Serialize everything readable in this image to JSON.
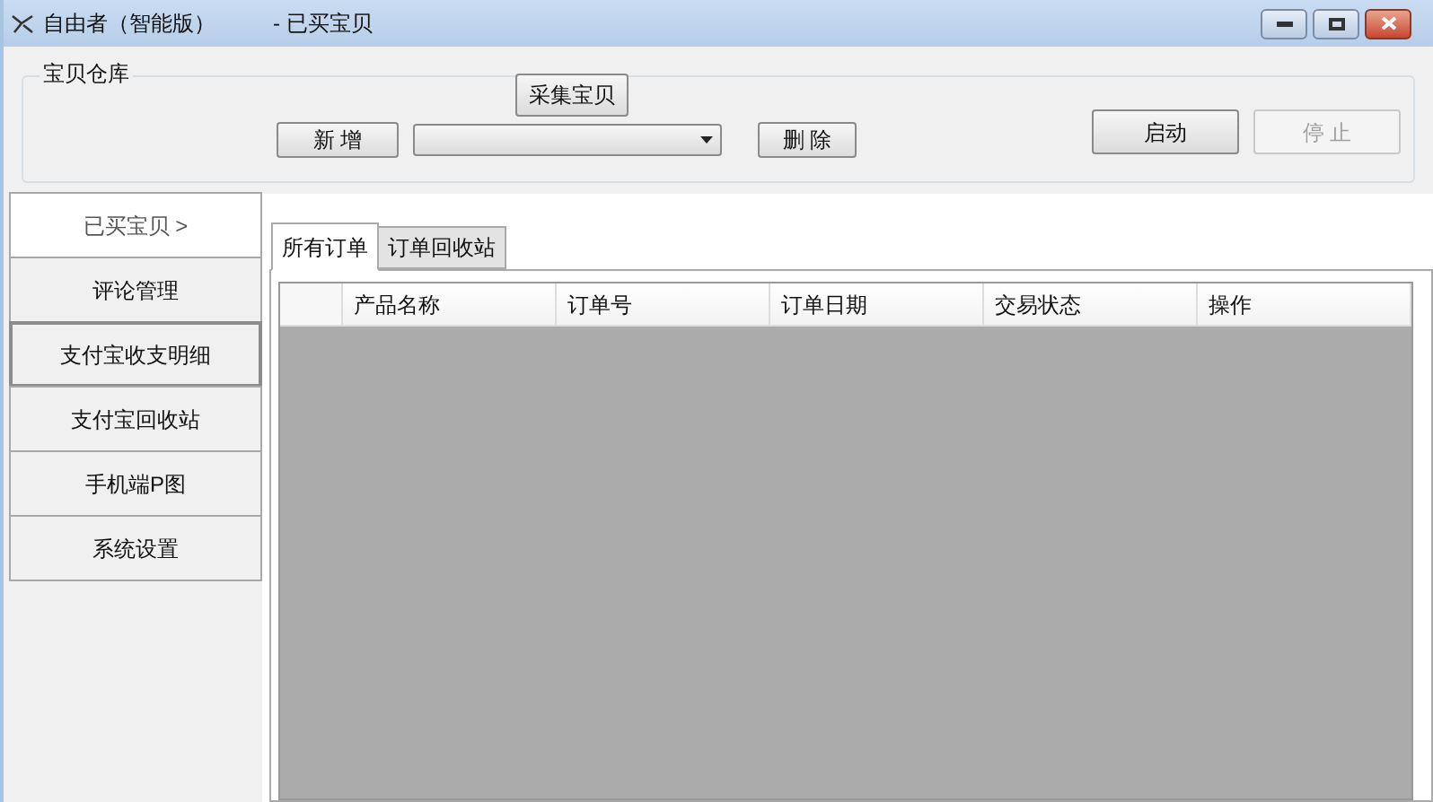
{
  "window": {
    "title": "自由者（智能版）",
    "subtitle": "- 已买宝贝"
  },
  "group": {
    "title": "宝贝仓库",
    "buttons": [
      {
        "label": "采集宝贝",
        "disabled": false
      },
      {
        "label": "新 增",
        "disabled": false
      },
      {
        "label": "删 除",
        "disabled": false
      },
      {
        "label": "启动",
        "disabled": false
      },
      {
        "label": "停 止",
        "disabled": true
      }
    ]
  },
  "sidebar": {
    "items": [
      {
        "label": "已买宝贝 >",
        "selected": true,
        "focused": false
      },
      {
        "label": "评论管理",
        "selected": false,
        "focused": false
      },
      {
        "label": "支付宝收支明细",
        "selected": false,
        "focused": true
      },
      {
        "label": "支付宝回收站",
        "selected": false,
        "focused": false
      },
      {
        "label": "手机端P图",
        "selected": false,
        "focused": false
      },
      {
        "label": "系统设置",
        "selected": false,
        "focused": false
      }
    ]
  },
  "tabs": [
    {
      "label": "所有订单",
      "selected": true
    },
    {
      "label": "订单回收站",
      "selected": false
    }
  ],
  "table": {
    "columns": [
      "产品名称",
      "订单号",
      "订单日期",
      "交易状态",
      "操作"
    ]
  }
}
